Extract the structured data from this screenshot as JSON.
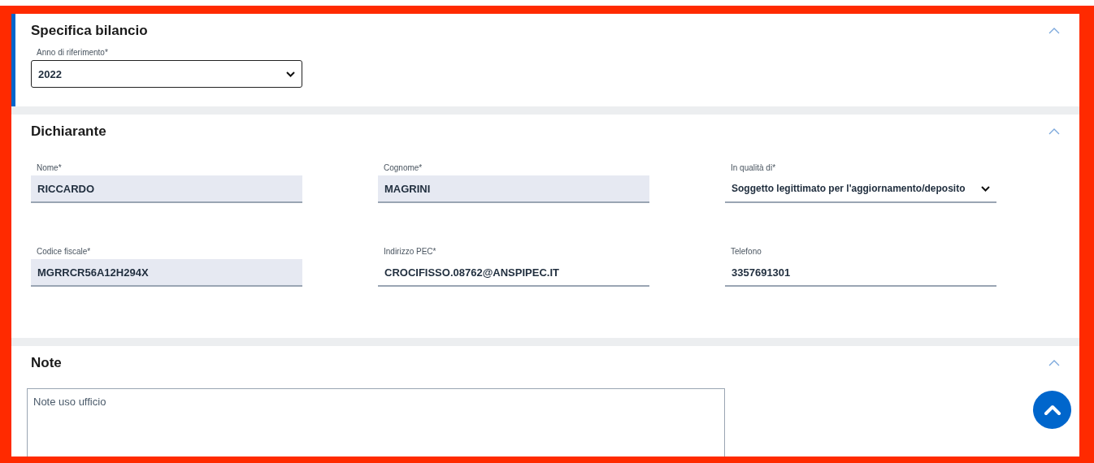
{
  "sections": [
    {
      "title": "Specifica bilancio",
      "active": true,
      "expanded": true,
      "fields": [
        {
          "kind": "select",
          "label": "Anno di riferimento*",
          "value": "2022"
        }
      ]
    },
    {
      "title": "Dichiarante",
      "active": false,
      "expanded": true,
      "fields": [
        {
          "kind": "readonly",
          "label": "Nome*",
          "value": "RICCARDO"
        },
        {
          "kind": "readonly",
          "label": "Cognome*",
          "value": "MAGRINI"
        },
        {
          "kind": "dropdown",
          "label": "In qualità di*",
          "value": "Soggetto legittimato per l'aggiornamento/deposito"
        },
        {
          "kind": "readonly",
          "label": "Codice fiscale*",
          "value": "MGRRCR56A12H294X"
        },
        {
          "kind": "text",
          "label": "Indirizzo PEC*",
          "value": "CROCIFISSO.08762@ANSPIPEC.IT"
        },
        {
          "kind": "text",
          "label": "Telefono",
          "value": "3357691301"
        }
      ]
    },
    {
      "title": "Note",
      "active": false,
      "expanded": true,
      "notes": {
        "placeholder": "Note uso ufficio"
      }
    }
  ]
}
